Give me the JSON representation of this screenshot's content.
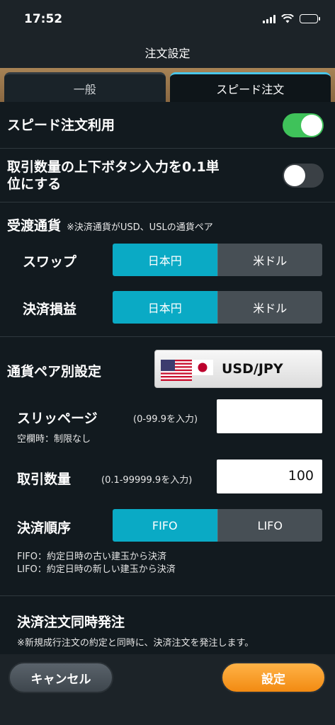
{
  "status": {
    "time": "17:52"
  },
  "nav": {
    "title": "注文設定"
  },
  "tabs": [
    {
      "label": "一般",
      "active": false
    },
    {
      "label": "スピード注文",
      "active": true
    }
  ],
  "speed_order": {
    "label": "スピード注文利用",
    "enabled": true
  },
  "step_toggle": {
    "label_line1": "取引数量の上下ボタン入力を0.1単",
    "label_line2": "位にする",
    "enabled": false
  },
  "settlement_currency": {
    "title": "受渡通貨",
    "note": "※決済通貨がUSD、USLの通貨ペア",
    "swap": {
      "label": "スワップ",
      "options": [
        "日本円",
        "米ドル"
      ],
      "selected": "日本円"
    },
    "pnl": {
      "label": "決済損益",
      "options": [
        "日本円",
        "米ドル"
      ],
      "selected": "日本円"
    }
  },
  "pair_settings": {
    "title": "通貨ペア別設定",
    "pair": "USD/JPY",
    "slippage": {
      "label": "スリッページ",
      "hint": "(0-99.9を入力)",
      "value": "",
      "note": "空欄時：制限なし"
    },
    "quantity": {
      "label": "取引数量",
      "hint": "(0.1-99999.9を入力)",
      "value": "100"
    },
    "order": {
      "label": "決済順序",
      "options": [
        "FIFO",
        "LIFO"
      ],
      "selected": "FIFO",
      "note_fifo": "FIFO：約定日時の古い建玉から決済",
      "note_lifo": "LIFO：約定日時の新しい建玉から決済"
    },
    "simultaneous": {
      "title": "決済注文同時発注",
      "note": "※新規成行注文の約定と同時に、決済注文を発注します。"
    }
  },
  "footer": {
    "cancel": "キャンセル",
    "ok": "設定"
  },
  "colors": {
    "accent": "#0aaac5",
    "toggle_on": "#3fc25a",
    "ok_button": "#f28a12",
    "tab_indicator": "#49c6ea"
  }
}
